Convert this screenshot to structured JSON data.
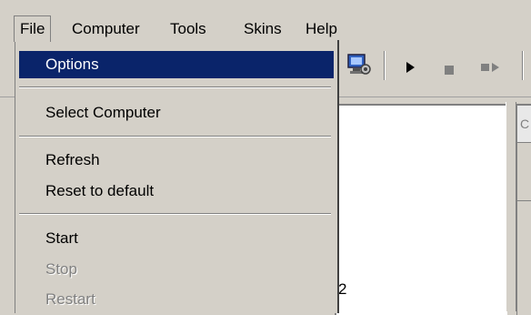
{
  "menubar": {
    "items": [
      {
        "label": "File"
      },
      {
        "label": "Computer"
      },
      {
        "label": "Tools"
      },
      {
        "label": "Skins"
      },
      {
        "label": "Help"
      }
    ]
  },
  "file_menu": {
    "options": "Options",
    "select_computer": "Select Computer",
    "refresh": "Refresh",
    "reset_to_default": "Reset to default",
    "start": "Start",
    "stop": "Stop",
    "restart": "Restart"
  },
  "toolbar": {
    "icons": [
      "computer-settings-icon",
      "play-icon",
      "stop-icon",
      "restart-icon"
    ]
  },
  "content": {
    "text": "2"
  },
  "colors": {
    "menu_bg": "#d4d0c8",
    "highlight": "#0a246a",
    "disabled_text": "#808080"
  }
}
